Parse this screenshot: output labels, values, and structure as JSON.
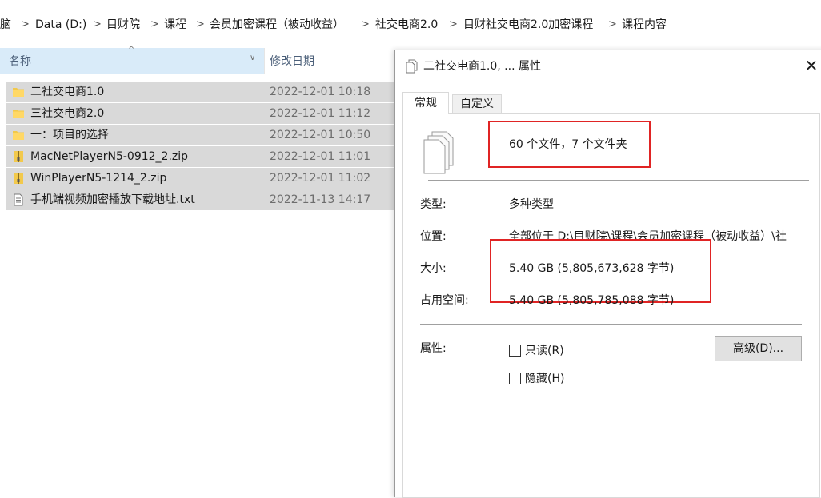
{
  "breadcrumb": {
    "items": [
      "脑",
      "Data (D:)",
      "目财院",
      "课程",
      "会员加密课程（被动收益）",
      "社交电商2.0",
      "目财社交电商2.0加密课程",
      "课程内容"
    ]
  },
  "file_list": {
    "columns": {
      "name": "名称",
      "modified": "修改日期"
    },
    "rows": [
      {
        "name": "二社交电商1.0",
        "date": "2022-12-01 10:18",
        "icon": "folder-icon"
      },
      {
        "name": "三社交电商2.0",
        "date": "2022-12-01 11:12",
        "icon": "folder-icon"
      },
      {
        "name": "一：项目的选择",
        "date": "2022-12-01 10:50",
        "icon": "folder-icon"
      },
      {
        "name": "MacNetPlayerN5-0912_2.zip",
        "date": "2022-12-01 11:01",
        "icon": "zip-icon"
      },
      {
        "name": "WinPlayerN5-1214_2.zip",
        "date": "2022-12-01 11:02",
        "icon": "zip-icon"
      },
      {
        "name": "手机端视频加密播放下载地址.txt",
        "date": "2022-11-13 14:17",
        "icon": "text-file-icon"
      }
    ]
  },
  "dialog": {
    "title": "二社交电商1.0, ... 属性",
    "close": "✕",
    "tabs": [
      "常规",
      "自定义"
    ],
    "summary": "60 个文件，7 个文件夹",
    "fields": {
      "type_label": "类型:",
      "type_value": "多种类型",
      "location_label": "位置:",
      "location_value": "全部位于 D:\\目财院\\课程\\会员加密课程（被动收益）\\社",
      "size_label": "大小:",
      "size_value": "5.40 GB (5,805,673,628 字节)",
      "disk_label": "占用空间:",
      "disk_value": "5.40 GB (5,805,785,088 字节)",
      "attr_label": "属性:",
      "readonly_label": "只读(R)",
      "hidden_label": "隐藏(H)",
      "advanced_button": "高级(D)..."
    }
  },
  "colors": {
    "selection": "#d9d9d9",
    "header_highlight": "#d9ebf9",
    "highlight_box": "#e02424",
    "folder": "#f2c94c"
  }
}
